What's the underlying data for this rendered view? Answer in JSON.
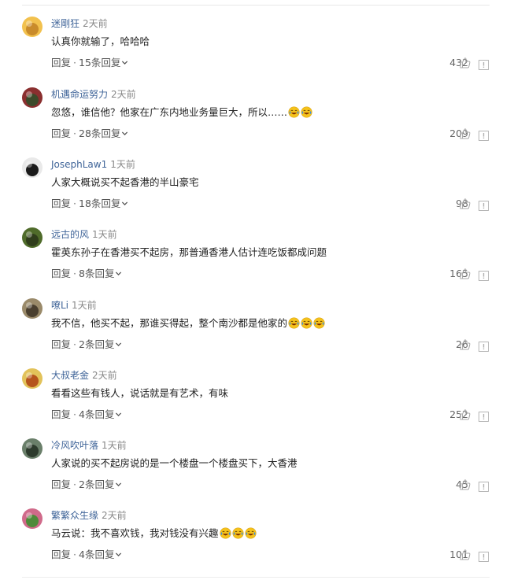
{
  "comments": [
    {
      "user": "迷剛狂",
      "time": "2天前",
      "text": "认真你就输了，哈哈哈",
      "emoji_count": 0,
      "reply_label": "回复",
      "replies_label": "15条回复",
      "likes": "432",
      "avatar_colors": [
        "#f2c14e",
        "#c98b2b"
      ]
    },
    {
      "user": "机遇命运努力",
      "time": "2天前",
      "text": "忽悠，谁信他？他家在广东内地业务量巨大，所以……",
      "emoji_count": 2,
      "reply_label": "回复",
      "replies_label": "28条回复",
      "likes": "209",
      "avatar_colors": [
        "#8a2f2f",
        "#3c4a2a"
      ]
    },
    {
      "user": "JosephLaw1",
      "time": "1天前",
      "text": "人家大概说买不起香港的半山豪宅",
      "emoji_count": 0,
      "reply_label": "回复",
      "replies_label": "18条回复",
      "likes": "98",
      "avatar_colors": [
        "#e9e9e9",
        "#1a1a1a"
      ]
    },
    {
      "user": "远古的风",
      "time": "1天前",
      "text": "霍英东孙子在香港买不起房，那普通香港人估计连吃饭都成问题",
      "emoji_count": 0,
      "reply_label": "回复",
      "replies_label": "8条回复",
      "likes": "165",
      "avatar_colors": [
        "#4f6b2a",
        "#2f3d1b"
      ]
    },
    {
      "user": "嘹Li",
      "time": "1天前",
      "text": "我不信，他买不起，那谁买得起，整个南沙都是他家的",
      "emoji_count": 3,
      "reply_label": "回复",
      "replies_label": "2条回复",
      "likes": "26",
      "avatar_colors": [
        "#9a8a6a",
        "#4a3f2f"
      ]
    },
    {
      "user": "大叔老金",
      "time": "2天前",
      "text": "看看这些有钱人，说话就是有艺术，有味",
      "emoji_count": 0,
      "reply_label": "回复",
      "replies_label": "4条回复",
      "likes": "252",
      "avatar_colors": [
        "#e2c25a",
        "#b5541c"
      ]
    },
    {
      "user": "冷风吹叶落",
      "time": "1天前",
      "text": "人家说的买不起房说的是一个楼盘一个楼盘买下，大香港",
      "emoji_count": 0,
      "reply_label": "回复",
      "replies_label": "2条回复",
      "likes": "45",
      "avatar_colors": [
        "#6a7f6a",
        "#2d3b2d"
      ]
    },
    {
      "user": "繁繁众生缘",
      "time": "2天前",
      "text": "马云说：我不喜欢钱，我对钱没有兴趣",
      "emoji_count": 3,
      "reply_label": "回复",
      "replies_label": "4条回复",
      "likes": "101",
      "avatar_colors": [
        "#d06a8a",
        "#4f8a3a"
      ]
    }
  ],
  "colors": {
    "username": "#406599",
    "time": "#888888",
    "body": "#222222",
    "action": "#555555",
    "icon": "#aaaaaa",
    "emoji_face": "#f5c21b",
    "emoji_tear": "#3d8fe0"
  },
  "icons": {
    "like": "thumbs-up-icon",
    "report": "report-flag-icon",
    "expand": "chevron-down-icon",
    "emoji": "crying-laughing-emoji-icon"
  }
}
